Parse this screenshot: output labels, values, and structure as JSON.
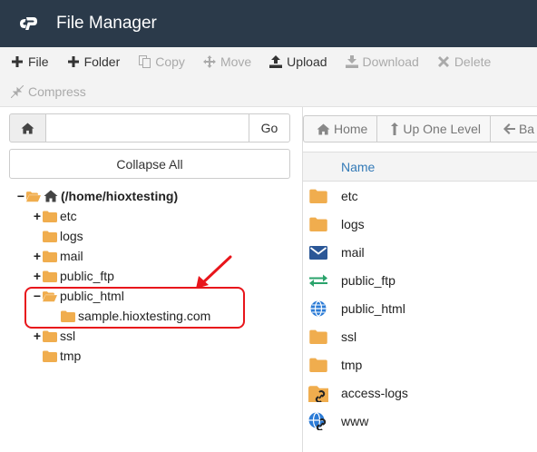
{
  "header": {
    "title": "File Manager",
    "logo_icon": "cpanel-logo-icon"
  },
  "toolbar": {
    "file": "File",
    "folder": "Folder",
    "copy": "Copy",
    "move": "Move",
    "upload": "Upload",
    "download": "Download",
    "delete": "Delete",
    "compress": "Compress"
  },
  "left": {
    "search": {
      "value": "",
      "placeholder": "",
      "go_label": "Go"
    },
    "collapse_label": "Collapse All",
    "tree": {
      "root": "(/home/hioxtesting)",
      "etc": "etc",
      "logs": "logs",
      "mail": "mail",
      "public_ftp": "public_ftp",
      "public_html": "public_html",
      "sample": "sample.hioxtesting.com",
      "ssl": "ssl",
      "tmp": "tmp"
    }
  },
  "right": {
    "nav": {
      "home": "Home",
      "up": "Up One Level",
      "back": "Ba"
    },
    "column_name": "Name",
    "rows": [
      {
        "name": "etc",
        "icon": "folder-icon"
      },
      {
        "name": "logs",
        "icon": "folder-icon"
      },
      {
        "name": "mail",
        "icon": "mail-icon"
      },
      {
        "name": "public_ftp",
        "icon": "transfer-icon"
      },
      {
        "name": "public_html",
        "icon": "globe-icon"
      },
      {
        "name": "ssl",
        "icon": "folder-icon"
      },
      {
        "name": "tmp",
        "icon": "folder-icon"
      },
      {
        "name": "access-logs",
        "icon": "folder-link-icon"
      },
      {
        "name": "www",
        "icon": "globe-link-icon"
      }
    ]
  },
  "colors": {
    "header_bg": "#2b3a4a",
    "folder": "#f0ad4e",
    "link_blue": "#337ab7",
    "highlight_red": "#e8151b",
    "transfer_green": "#2aa36b"
  }
}
